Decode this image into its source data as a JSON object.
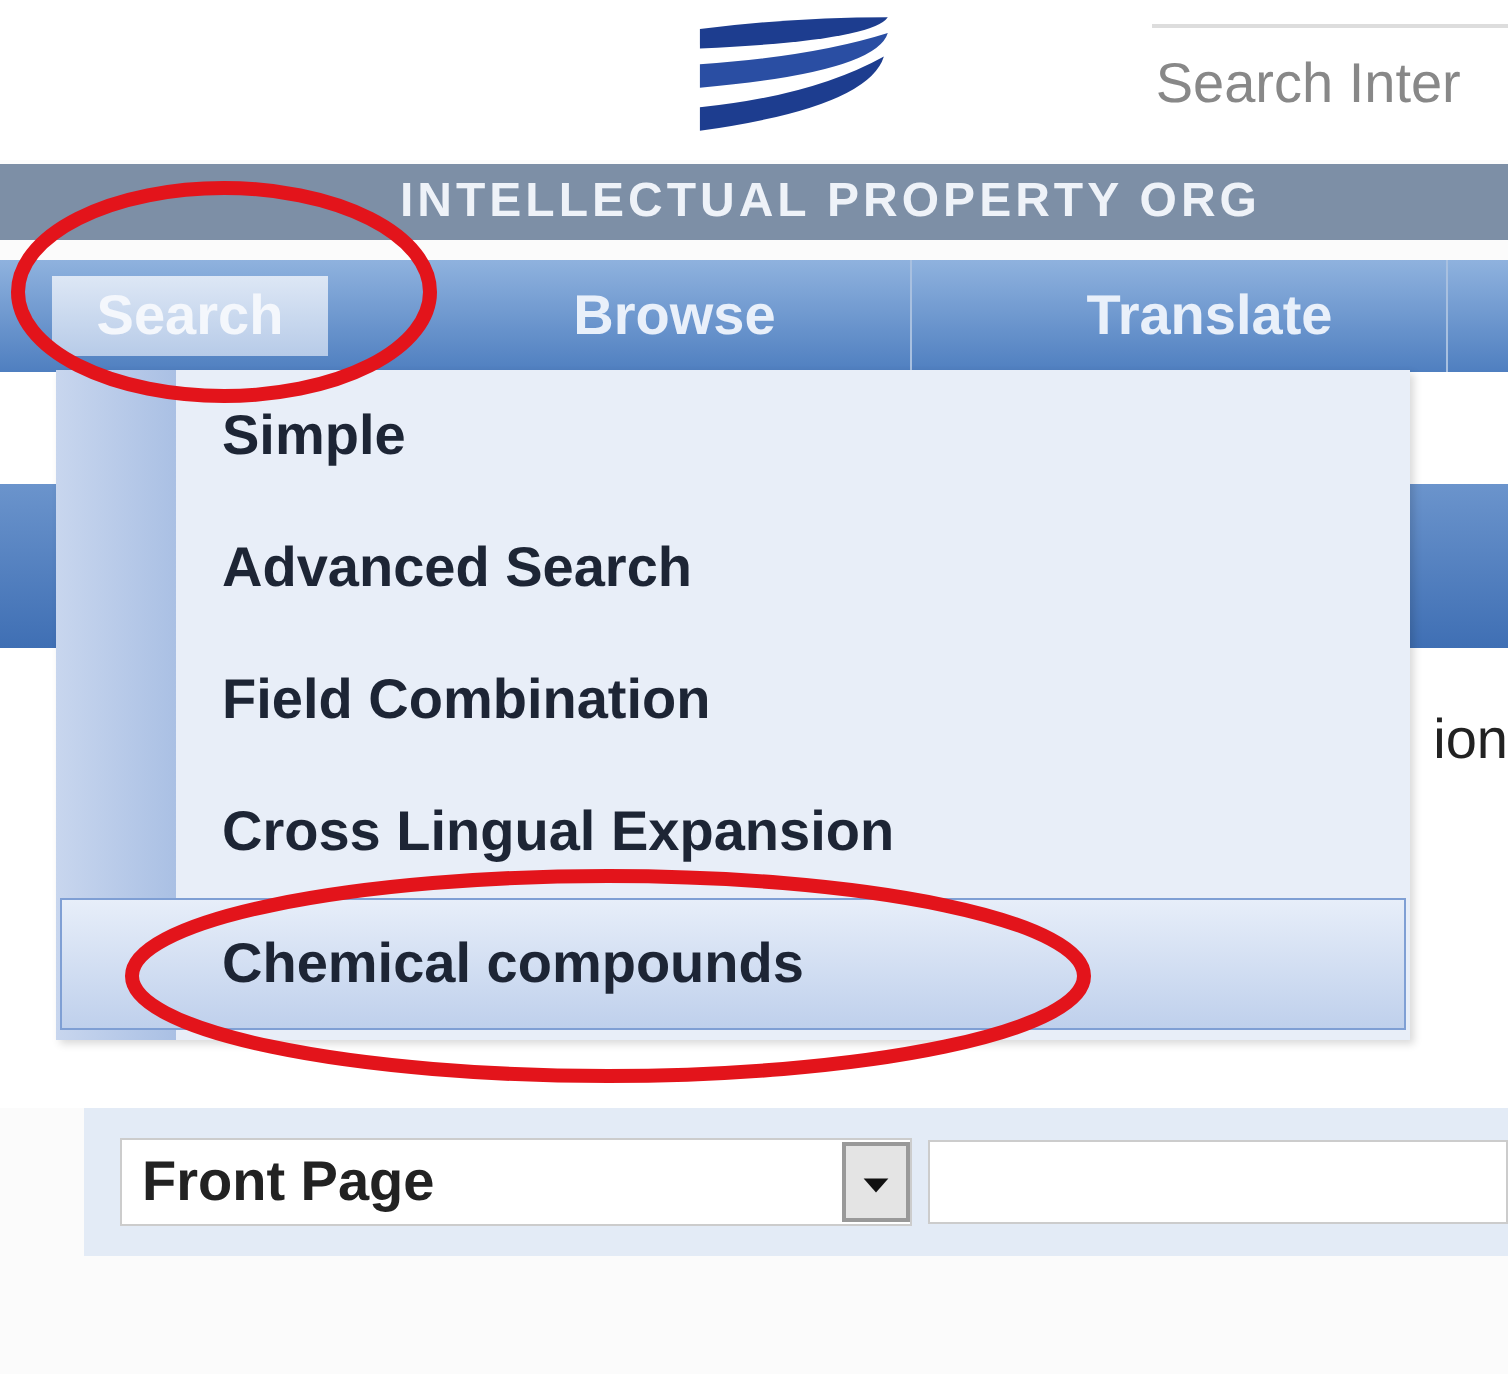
{
  "header": {
    "search_placeholder": "Search Inter"
  },
  "banner": {
    "title": "INTELLECTUAL PROPERTY ORG"
  },
  "nav": [
    {
      "label": "Search",
      "selected": true
    },
    {
      "label": "Browse",
      "selected": false
    },
    {
      "label": "Translate",
      "selected": false
    }
  ],
  "search_menu": [
    {
      "label": "Simple",
      "selected": false
    },
    {
      "label": "Advanced Search",
      "selected": false
    },
    {
      "label": "Field Combination",
      "selected": false
    },
    {
      "label": "Cross Lingual Expansion",
      "selected": false
    },
    {
      "label": "Chemical compounds",
      "selected": true
    }
  ],
  "behind_text": "ion",
  "query": {
    "field": "Front Page"
  }
}
